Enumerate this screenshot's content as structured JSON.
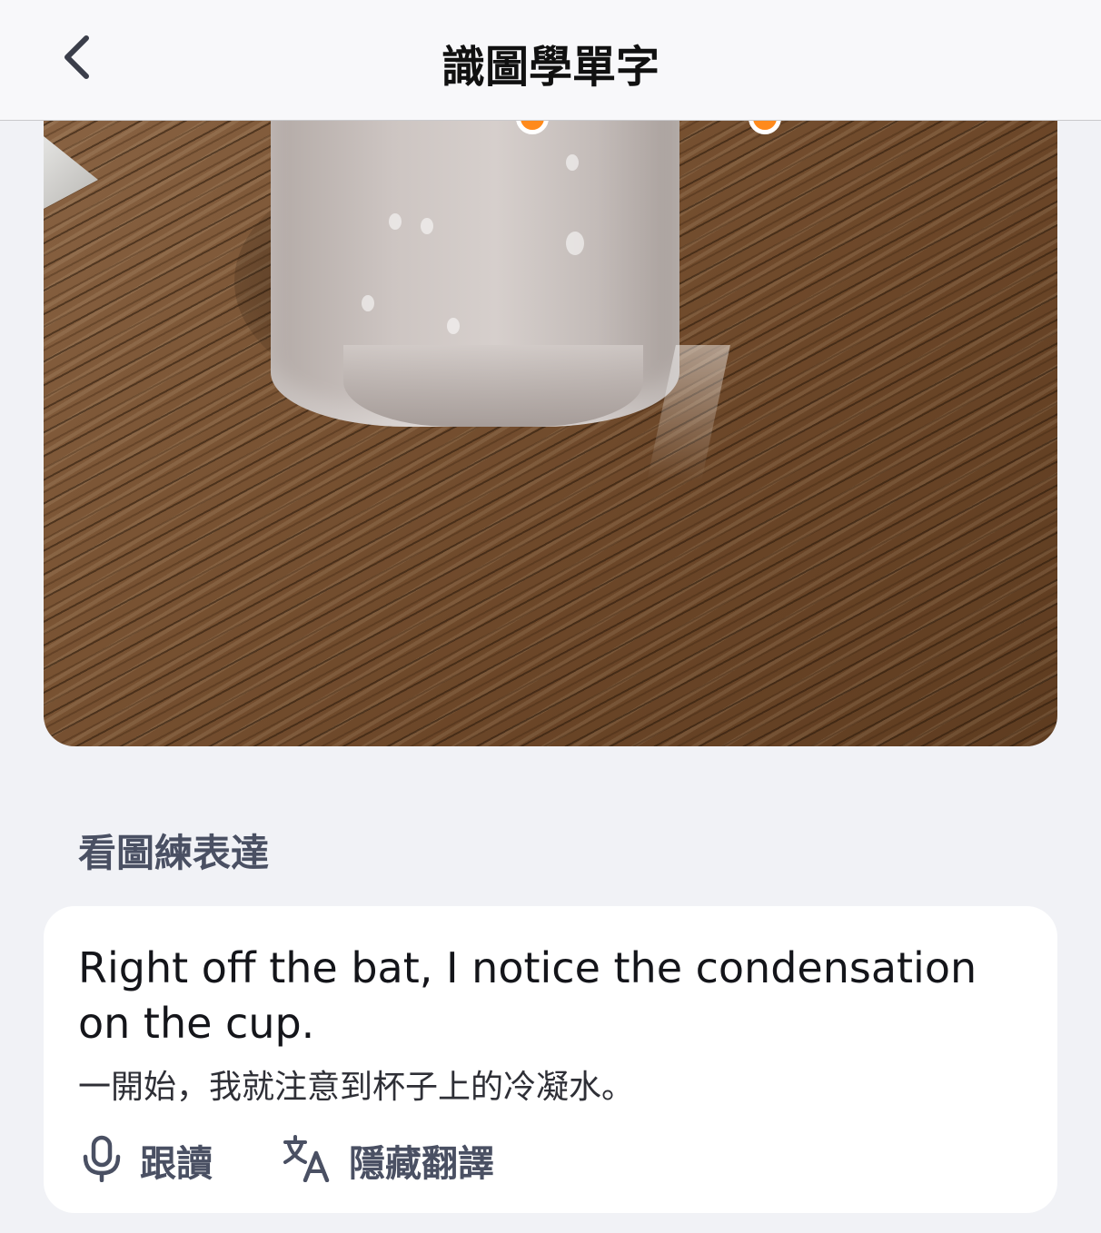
{
  "navbar": {
    "title": "識圖學單字",
    "back_icon": "chevron-left-icon"
  },
  "photo": {
    "description_hotspot_color": "#ff8a1c"
  },
  "section": {
    "title": "看圖練表達"
  },
  "expression_card": {
    "sentence": "Right off the bat, I notice the condensation on the cup.",
    "translation": "一開始，我就注意到杯子上的冷凝水。",
    "actions": [
      {
        "icon": "microphone-icon",
        "label": "跟讀"
      },
      {
        "icon": "translate-icon",
        "label": "隱藏翻譯"
      }
    ]
  },
  "colors": {
    "background": "#f1f2f6",
    "card": "#ffffff",
    "muted_text": "#4a5063",
    "accent_orange": "#ff8a1c"
  }
}
